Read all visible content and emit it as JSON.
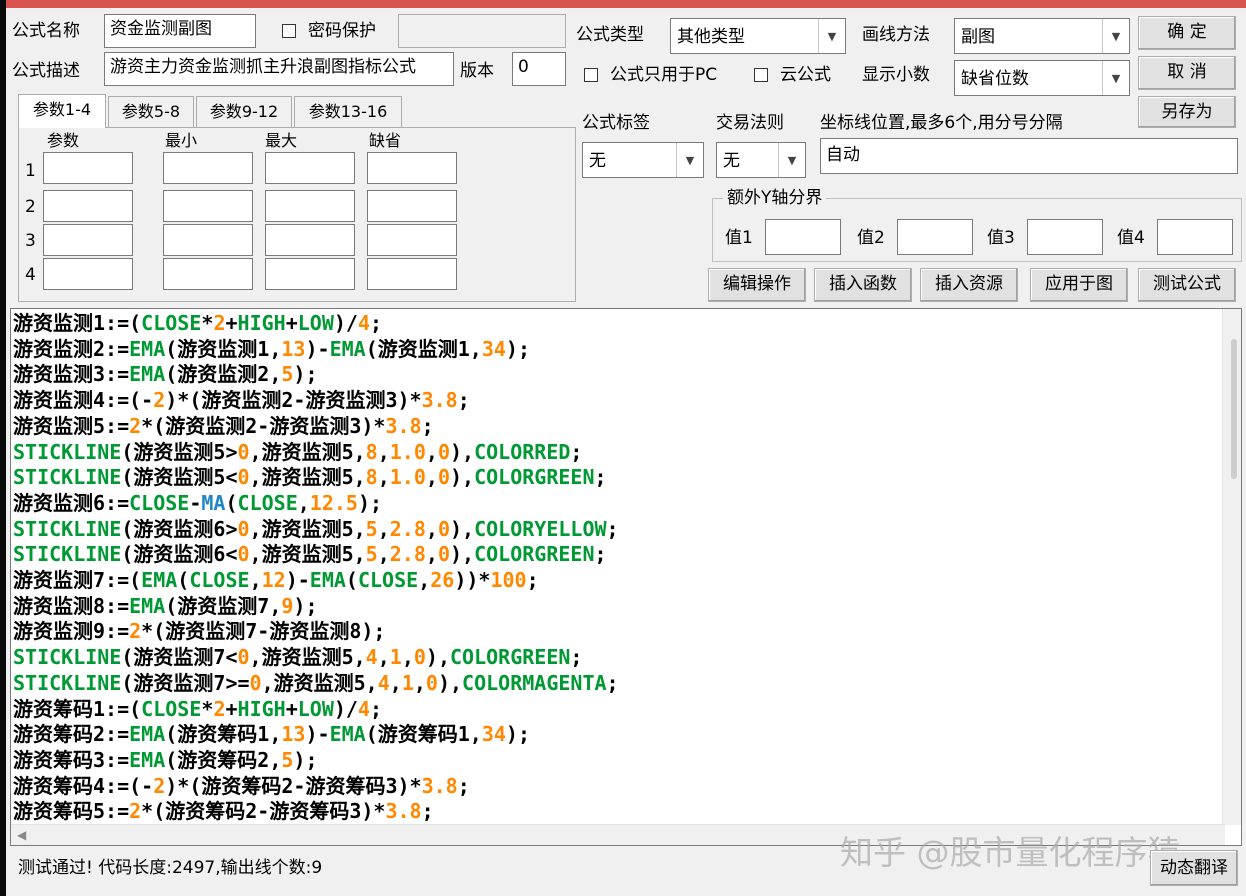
{
  "form": {
    "name_label": "公式名称",
    "name_value": "资金监测副图",
    "password_label": "密码保护",
    "desc_label": "公式描述",
    "desc_value": "游资主力资金监测抓主升浪副图指标公式",
    "version_label": "版本",
    "version_value": "0",
    "type_label": "公式类型",
    "type_value": "其他类型",
    "draw_label": "画线方法",
    "draw_value": "副图",
    "pc_only_label": "公式只用于PC",
    "cloud_label": "云公式",
    "decimal_label": "显示小数",
    "decimal_value": "缺省位数",
    "tag_label": "公式标签",
    "tag_value": "无",
    "rule_label": "交易法则",
    "rule_value": "无",
    "coord_label": "坐标线位置,最多6个,用分号分隔",
    "coord_value": "自动",
    "yaxis_group_label": "额外Y轴分界",
    "yaxis_values": [
      "值1",
      "值2",
      "值3",
      "值4"
    ]
  },
  "buttons": {
    "ok": "确  定",
    "cancel": "取  消",
    "save_as": "另存为",
    "edit": "编辑操作",
    "insert_func": "插入函数",
    "insert_res": "插入资源",
    "apply": "应用于图",
    "test": "测试公式",
    "dynamic": "动态翻译"
  },
  "params": {
    "tabs": [
      "参数1-4",
      "参数5-8",
      "参数9-12",
      "参数13-16"
    ],
    "headers": [
      "参数",
      "最小",
      "最大",
      "缺省"
    ],
    "rows": [
      "1",
      "2",
      "3",
      "4"
    ]
  },
  "code": [
    [
      [
        "p",
        "游资监测1:=("
      ],
      [
        "k",
        "CLOSE"
      ],
      [
        "p",
        "*"
      ],
      [
        "n",
        "2"
      ],
      [
        "p",
        "+"
      ],
      [
        "k",
        "HIGH"
      ],
      [
        "p",
        "+"
      ],
      [
        "k",
        "LOW"
      ],
      [
        "p",
        ")/"
      ],
      [
        "n",
        "4"
      ],
      [
        "p",
        ";"
      ]
    ],
    [
      [
        "p",
        "游资监测2:="
      ],
      [
        "k",
        "EMA"
      ],
      [
        "p",
        "(游资监测1,"
      ],
      [
        "n",
        "13"
      ],
      [
        "p",
        ")-"
      ],
      [
        "k",
        "EMA"
      ],
      [
        "p",
        "(游资监测1,"
      ],
      [
        "n",
        "34"
      ],
      [
        "p",
        ");"
      ]
    ],
    [
      [
        "p",
        "游资监测3:="
      ],
      [
        "k",
        "EMA"
      ],
      [
        "p",
        "(游资监测2,"
      ],
      [
        "n",
        "5"
      ],
      [
        "p",
        ");"
      ]
    ],
    [
      [
        "p",
        "游资监测4:=(-"
      ],
      [
        "n",
        "2"
      ],
      [
        "p",
        ")*(游资监测2-游资监测3)*"
      ],
      [
        "n",
        "3.8"
      ],
      [
        "p",
        ";"
      ]
    ],
    [
      [
        "p",
        "游资监测5:="
      ],
      [
        "n",
        "2"
      ],
      [
        "p",
        "*(游资监测2-游资监测3)*"
      ],
      [
        "n",
        "3.8"
      ],
      [
        "p",
        ";"
      ]
    ],
    [
      [
        "k",
        "STICKLINE"
      ],
      [
        "p",
        "(游资监测5>"
      ],
      [
        "n",
        "0"
      ],
      [
        "p",
        ",游资监测5,"
      ],
      [
        "n",
        "8"
      ],
      [
        "p",
        ","
      ],
      [
        "n",
        "1.0"
      ],
      [
        "p",
        ","
      ],
      [
        "n",
        "0"
      ],
      [
        "p",
        "),"
      ],
      [
        "k",
        "COLORRED"
      ],
      [
        "p",
        ";"
      ]
    ],
    [
      [
        "k",
        "STICKLINE"
      ],
      [
        "p",
        "(游资监测5<"
      ],
      [
        "n",
        "0"
      ],
      [
        "p",
        ",游资监测5,"
      ],
      [
        "n",
        "8"
      ],
      [
        "p",
        ","
      ],
      [
        "n",
        "1.0"
      ],
      [
        "p",
        ","
      ],
      [
        "n",
        "0"
      ],
      [
        "p",
        "),"
      ],
      [
        "k",
        "COLORGREEN"
      ],
      [
        "p",
        ";"
      ]
    ],
    [
      [
        "p",
        "游资监测6:="
      ],
      [
        "k",
        "CLOSE"
      ],
      [
        "p",
        "-"
      ],
      [
        "m",
        "MA"
      ],
      [
        "p",
        "("
      ],
      [
        "k",
        "CLOSE"
      ],
      [
        "p",
        ","
      ],
      [
        "n",
        "12.5"
      ],
      [
        "p",
        ");"
      ]
    ],
    [
      [
        "k",
        "STICKLINE"
      ],
      [
        "p",
        "(游资监测6>"
      ],
      [
        "n",
        "0"
      ],
      [
        "p",
        ",游资监测5,"
      ],
      [
        "n",
        "5"
      ],
      [
        "p",
        ","
      ],
      [
        "n",
        "2.8"
      ],
      [
        "p",
        ","
      ],
      [
        "n",
        "0"
      ],
      [
        "p",
        "),"
      ],
      [
        "k",
        "COLORYELLOW"
      ],
      [
        "p",
        ";"
      ]
    ],
    [
      [
        "k",
        "STICKLINE"
      ],
      [
        "p",
        "(游资监测6<"
      ],
      [
        "n",
        "0"
      ],
      [
        "p",
        ",游资监测5,"
      ],
      [
        "n",
        "5"
      ],
      [
        "p",
        ","
      ],
      [
        "n",
        "2.8"
      ],
      [
        "p",
        ","
      ],
      [
        "n",
        "0"
      ],
      [
        "p",
        "),"
      ],
      [
        "k",
        "COLORGREEN"
      ],
      [
        "p",
        ";"
      ]
    ],
    [
      [
        "p",
        "游资监测7:=("
      ],
      [
        "k",
        "EMA"
      ],
      [
        "p",
        "("
      ],
      [
        "k",
        "CLOSE"
      ],
      [
        "p",
        ","
      ],
      [
        "n",
        "12"
      ],
      [
        "p",
        ")-"
      ],
      [
        "k",
        "EMA"
      ],
      [
        "p",
        "("
      ],
      [
        "k",
        "CLOSE"
      ],
      [
        "p",
        ","
      ],
      [
        "n",
        "26"
      ],
      [
        "p",
        "))*"
      ],
      [
        "n",
        "100"
      ],
      [
        "p",
        ";"
      ]
    ],
    [
      [
        "p",
        "游资监测8:="
      ],
      [
        "k",
        "EMA"
      ],
      [
        "p",
        "(游资监测7,"
      ],
      [
        "n",
        "9"
      ],
      [
        "p",
        ");"
      ]
    ],
    [
      [
        "p",
        "游资监测9:="
      ],
      [
        "n",
        "2"
      ],
      [
        "p",
        "*(游资监测7-游资监测8);"
      ]
    ],
    [
      [
        "k",
        "STICKLINE"
      ],
      [
        "p",
        "(游资监测7<"
      ],
      [
        "n",
        "0"
      ],
      [
        "p",
        ",游资监测5,"
      ],
      [
        "n",
        "4"
      ],
      [
        "p",
        ","
      ],
      [
        "n",
        "1"
      ],
      [
        "p",
        ","
      ],
      [
        "n",
        "0"
      ],
      [
        "p",
        "),"
      ],
      [
        "k",
        "COLORGREEN"
      ],
      [
        "p",
        ";"
      ]
    ],
    [
      [
        "k",
        "STICKLINE"
      ],
      [
        "p",
        "(游资监测7>="
      ],
      [
        "n",
        "0"
      ],
      [
        "p",
        ",游资监测5,"
      ],
      [
        "n",
        "4"
      ],
      [
        "p",
        ","
      ],
      [
        "n",
        "1"
      ],
      [
        "p",
        ","
      ],
      [
        "n",
        "0"
      ],
      [
        "p",
        "),"
      ],
      [
        "k",
        "COLORMAGENTA"
      ],
      [
        "p",
        ";"
      ]
    ],
    [
      [
        "p",
        "游资筹码1:=("
      ],
      [
        "k",
        "CLOSE"
      ],
      [
        "p",
        "*"
      ],
      [
        "n",
        "2"
      ],
      [
        "p",
        "+"
      ],
      [
        "k",
        "HIGH"
      ],
      [
        "p",
        "+"
      ],
      [
        "k",
        "LOW"
      ],
      [
        "p",
        ")/"
      ],
      [
        "n",
        "4"
      ],
      [
        "p",
        ";"
      ]
    ],
    [
      [
        "p",
        "游资筹码2:="
      ],
      [
        "k",
        "EMA"
      ],
      [
        "p",
        "(游资筹码1,"
      ],
      [
        "n",
        "13"
      ],
      [
        "p",
        ")-"
      ],
      [
        "k",
        "EMA"
      ],
      [
        "p",
        "(游资筹码1,"
      ],
      [
        "n",
        "34"
      ],
      [
        "p",
        ");"
      ]
    ],
    [
      [
        "p",
        "游资筹码3:="
      ],
      [
        "k",
        "EMA"
      ],
      [
        "p",
        "(游资筹码2,"
      ],
      [
        "n",
        "5"
      ],
      [
        "p",
        ");"
      ]
    ],
    [
      [
        "p",
        "游资筹码4:=(-"
      ],
      [
        "n",
        "2"
      ],
      [
        "p",
        ")*(游资筹码2-游资筹码3)*"
      ],
      [
        "n",
        "3.8"
      ],
      [
        "p",
        ";"
      ]
    ],
    [
      [
        "p",
        "游资筹码5:="
      ],
      [
        "n",
        "2"
      ],
      [
        "p",
        "*(游资筹码2-游资筹码3)*"
      ],
      [
        "n",
        "3.8"
      ],
      [
        "p",
        ";"
      ]
    ]
  ],
  "status": "测试通过! 代码长度:2497,输出线个数:9",
  "watermark": "知乎 @股市量化程序猿"
}
